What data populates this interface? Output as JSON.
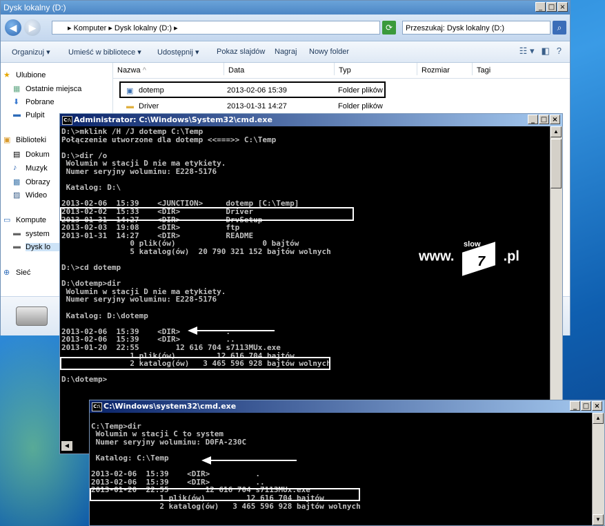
{
  "explorer": {
    "title": "Dysk lokalny (D:)",
    "address": "▸ Komputer ▸ Dysk lokalny (D:) ▸",
    "search_placeholder": "Przeszukaj: Dysk lokalny (D:)",
    "toolbar": {
      "organize": "Organizuj ▾",
      "include": "Umieść w bibliotece ▾",
      "share": "Udostępnij ▾",
      "slideshow": "Pokaz slajdów",
      "burn": "Nagraj",
      "new_folder": "Nowy folder"
    },
    "nav": {
      "favorites": "Ulubione",
      "recent": "Ostatnie miejsca",
      "downloads": "Pobrane",
      "desktop": "Pulpit",
      "libraries": "Biblioteki",
      "docs": "Dokum",
      "music": "Muzyk",
      "pictures": "Obrazy",
      "videos": "Wideo",
      "computer": "Kompute",
      "system": "system",
      "disk": "Dysk lo",
      "network": "Sieć"
    },
    "columns": {
      "name": "Nazwa",
      "date": "Data",
      "type": "Typ",
      "size": "Rozmiar",
      "tags": "Tagi"
    },
    "rows": [
      {
        "name": "dotemp",
        "date": "2013-02-06 15:39",
        "type": "Folder plików"
      },
      {
        "name": "Driver",
        "date": "2013-01-31 14:27",
        "type": "Folder plików"
      }
    ]
  },
  "cmd1": {
    "title": "Administrator: C:\\Windows\\System32\\cmd.exe",
    "lines": [
      "D:\\>mklink /H /J dotemp C:\\Temp",
      "Połączenie utworzone dla dotemp <<===>> C:\\Temp",
      "",
      "D:\\>dir /o",
      " Wolumin w stacji D nie ma etykiety.",
      " Numer seryjny woluminu: E228-5176",
      "",
      " Katalog: D:\\",
      "",
      "2013-02-06  15:39    <JUNCTION>     dotemp [C:\\Temp]",
      "2013-02-02  15:33    <DIR>          Driver",
      "2013-01-31  14:27    <DIR>          DrvSetup",
      "2013-02-03  19:08    <DIR>          ftp",
      "2013-01-31  14:27    <DIR>          README",
      "               0 plik(ów)                   0 bajtów",
      "               5 katalog(ów)  20 790 321 152 bajtów wolnych",
      "",
      "D:\\>cd dotemp",
      "",
      "D:\\dotemp>dir",
      " Wolumin w stacji D nie ma etykiety.",
      " Numer seryjny woluminu: E228-5176",
      "",
      " Katalog: D:\\dotemp",
      "",
      "2013-02-06  15:39    <DIR>          .",
      "2013-02-06  15:39    <DIR>          ..",
      "2013-01-20  22:55        12 616 704 s7113MUx.exe",
      "               1 plik(ów)         12 616 704 bajtów",
      "               2 katalog(ów)   3 465 596 928 bajtów wolnych",
      "",
      "D:\\dotemp>"
    ]
  },
  "cmd2": {
    "title": "C:\\Windows\\system32\\cmd.exe",
    "lines": [
      "",
      "C:\\Temp>dir",
      " Wolumin w stacji C to system",
      " Numer seryjny woluminu: D0FA-230C",
      "",
      " Katalog: C:\\Temp",
      "",
      "2013-02-06  15:39    <DIR>          .",
      "2013-02-06  15:39    <DIR>          ..",
      "2013-01-20  22:55        12 616 704 s7113MUx.exe",
      "               1 plik(ów)         12 616 704 bajtów",
      "               2 katalog(ów)   3 465 596 928 bajtów wolnych"
    ]
  },
  "logo": {
    "prefix": "www.",
    "badge_top": "slow",
    "badge_num": "7",
    "suffix": ".pl"
  }
}
